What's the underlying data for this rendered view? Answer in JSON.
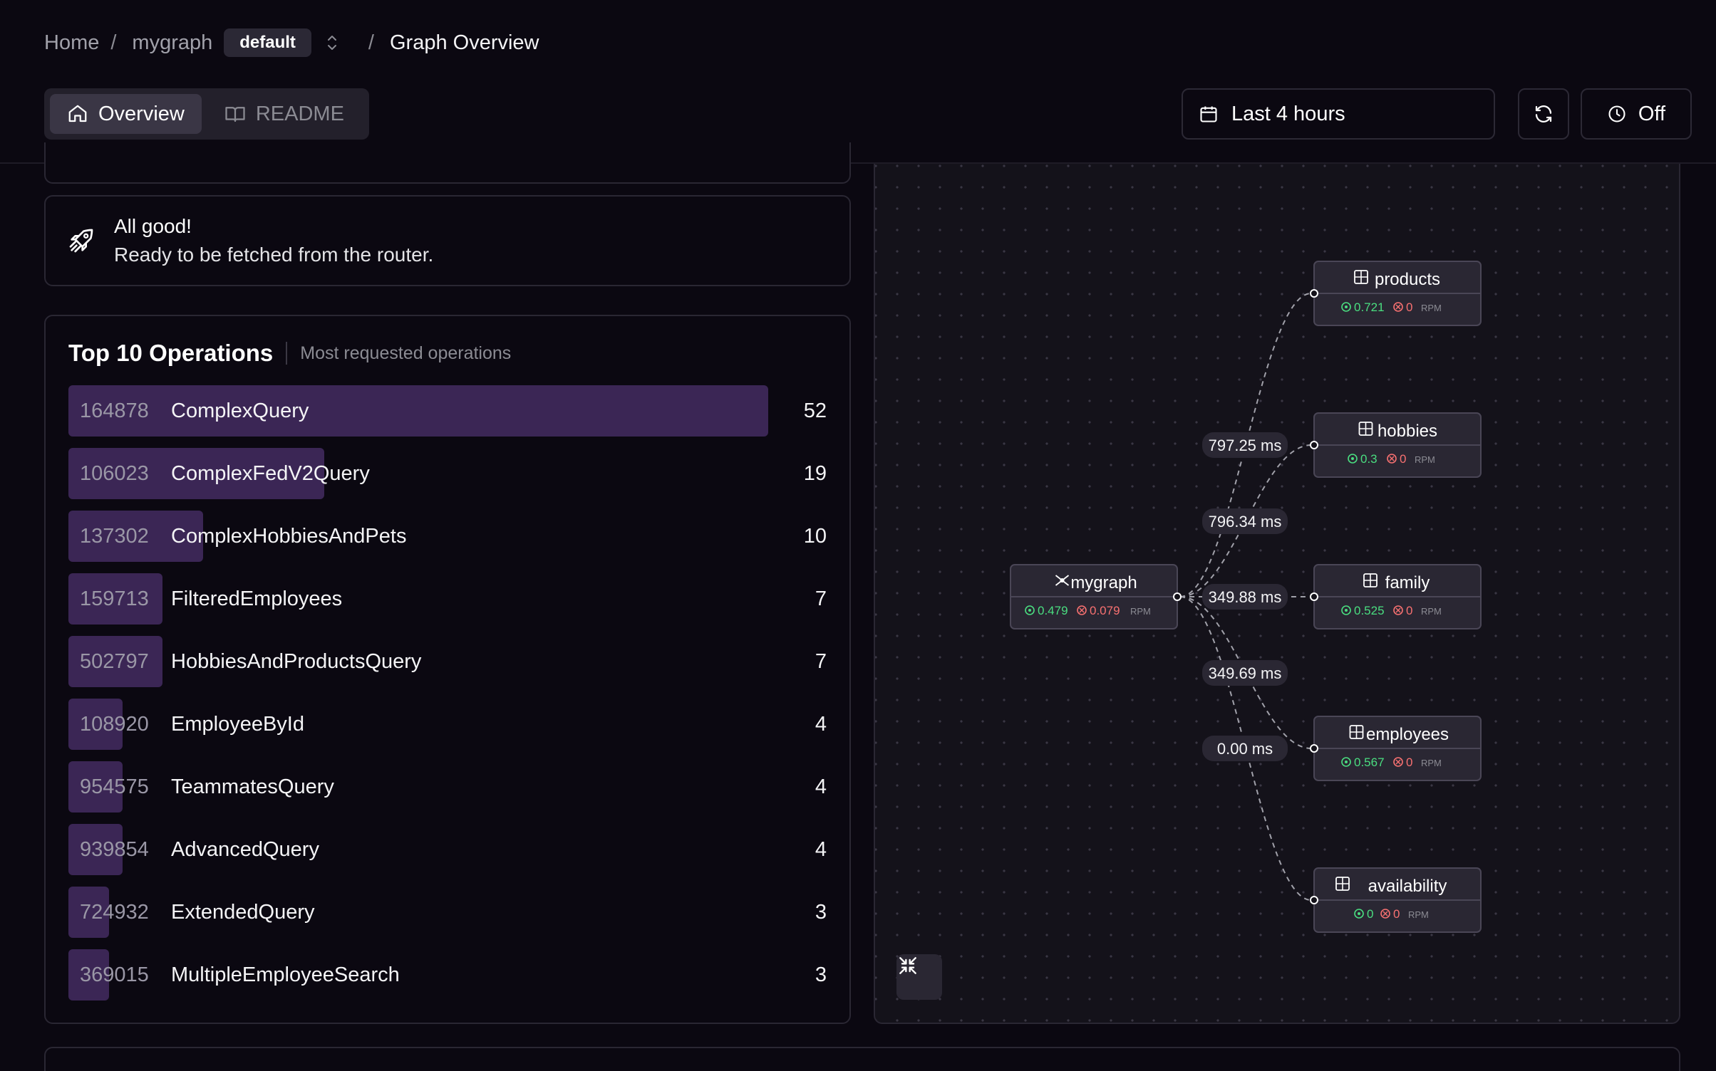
{
  "breadcrumb": {
    "home": "Home",
    "sep": "/",
    "graph": "mygraph",
    "namespace": "default",
    "current": "Graph Overview"
  },
  "tabs": [
    {
      "label": "Overview",
      "icon": "home-icon",
      "active": true
    },
    {
      "label": "README",
      "icon": "book-icon",
      "active": false
    }
  ],
  "toolbar": {
    "time_range": "Last 4 hours",
    "auto_refresh": "Off"
  },
  "status": {
    "title": "All good!",
    "message": "Ready to be fetched from the router.",
    "icon": "rocket-icon"
  },
  "operations": {
    "title": "Top 10 Operations",
    "subtitle": "Most requested operations",
    "rows": [
      {
        "id": "164878",
        "name": "ComplexQuery",
        "count": "52"
      },
      {
        "id": "106023",
        "name": "ComplexFedV2Query",
        "count": "19"
      },
      {
        "id": "137302",
        "name": "ComplexHobbiesAndPets",
        "count": "10"
      },
      {
        "id": "159713",
        "name": "FilteredEmployees",
        "count": "7"
      },
      {
        "id": "502797",
        "name": "HobbiesAndProductsQuery",
        "count": "7"
      },
      {
        "id": "108920",
        "name": "EmployeeById",
        "count": "4"
      },
      {
        "id": "954575",
        "name": "TeammatesQuery",
        "count": "4"
      },
      {
        "id": "939854",
        "name": "AdvancedQuery",
        "count": "4"
      },
      {
        "id": "724932",
        "name": "ExtendedQuery",
        "count": "3"
      },
      {
        "id": "369015",
        "name": "MultipleEmployeeSearch",
        "count": "3"
      }
    ]
  },
  "graph": {
    "router": {
      "name": "mygraph",
      "ok": "0.479",
      "err": "0.079",
      "unit": "RPM"
    },
    "subgraphs": [
      {
        "name": "products",
        "ok": "0.721",
        "err": "0",
        "unit": "RPM"
      },
      {
        "name": "hobbies",
        "ok": "0.3",
        "err": "0",
        "unit": "RPM"
      },
      {
        "name": "family",
        "ok": "0.525",
        "err": "0",
        "unit": "RPM"
      },
      {
        "name": "employees",
        "ok": "0.567",
        "err": "0",
        "unit": "RPM"
      },
      {
        "name": "availability",
        "ok": "0",
        "err": "0",
        "unit": "RPM"
      }
    ],
    "latencies": [
      "797.25 ms",
      "796.34 ms",
      "349.88 ms",
      "349.69 ms",
      "0.00 ms"
    ]
  },
  "colors": {
    "ok": "#4ade80",
    "error": "#f87171",
    "bar": "#3b2655"
  }
}
